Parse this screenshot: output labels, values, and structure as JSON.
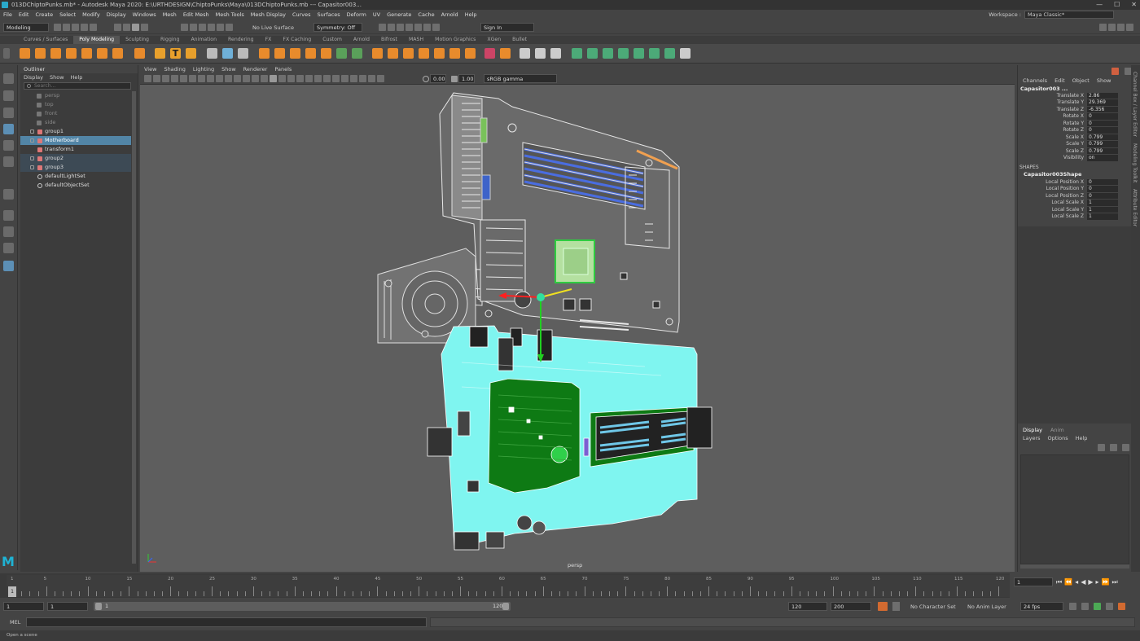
{
  "titlebar": {
    "title": "013DChiptoPunks.mb* - Autodesk Maya 2020: E:\\URTHDESIGN\\ChiptoPunks\\Maya\\013DChiptoPunks.mb   ---   Capasitor003..."
  },
  "window_controls": {
    "minimize": "—",
    "maximize": "☐",
    "close": "✕"
  },
  "menubar": [
    "File",
    "Edit",
    "Create",
    "Select",
    "Modify",
    "Display",
    "Windows",
    "Mesh",
    "Edit Mesh",
    "Mesh Tools",
    "Mesh Display",
    "Curves",
    "Surfaces",
    "Deform",
    "UV",
    "Generate",
    "Cache",
    "Arnold",
    "Help"
  ],
  "workspace": {
    "label": "Workspace :",
    "value": "Maya Classic*"
  },
  "statusline": {
    "mode": "Modeling",
    "live_surface": "No Live Surface",
    "symmetry": "Symmetry: Off",
    "signin": "Sign In"
  },
  "shelf_tabs": [
    "Curves / Surfaces",
    "Poly Modeling",
    "Sculpting",
    "Rigging",
    "Animation",
    "Rendering",
    "FX",
    "FX Caching",
    "Custom",
    "Arnold",
    "Bifrost",
    "MASH",
    "Motion Graphics",
    "XGen",
    "Bullet"
  ],
  "shelf_active": "Poly Modeling",
  "outliner": {
    "title": "Outliner",
    "menu": [
      "Display",
      "Show",
      "Help"
    ],
    "search_placeholder": "Search...",
    "items": [
      {
        "label": "persp",
        "state": "dim",
        "indent": 1
      },
      {
        "label": "top",
        "state": "dim",
        "indent": 1
      },
      {
        "label": "front",
        "state": "dim",
        "indent": 1
      },
      {
        "label": "side",
        "state": "dim",
        "indent": 1
      },
      {
        "label": "group1",
        "state": "normal",
        "indent": 0,
        "expand": true
      },
      {
        "label": "Motherboard",
        "state": "highlight",
        "indent": 0,
        "expand": true
      },
      {
        "label": "transform1",
        "state": "normal",
        "indent": 0
      },
      {
        "label": "group2",
        "state": "selected",
        "indent": 0,
        "expand": true
      },
      {
        "label": "group3",
        "state": "selected",
        "indent": 0,
        "expand": true
      },
      {
        "label": "defaultLightSet",
        "state": "normal",
        "indent": 0
      },
      {
        "label": "defaultObjectSet",
        "state": "normal",
        "indent": 0
      }
    ]
  },
  "viewport": {
    "menu": [
      "View",
      "Shading",
      "Lighting",
      "Show",
      "Renderer",
      "Panels"
    ],
    "exposure": "0.00",
    "gamma": "1.00",
    "colorspace": "sRGB gamma",
    "camera_label": "persp"
  },
  "channel_box": {
    "menu": [
      "Channels",
      "Edit",
      "Object",
      "Show"
    ],
    "object": "Capasitor003 ...",
    "attributes": [
      {
        "name": "Translate X",
        "value": "2.86"
      },
      {
        "name": "Translate Y",
        "value": "29.369"
      },
      {
        "name": "Translate Z",
        "value": "-6.356"
      },
      {
        "name": "Rotate X",
        "value": "0"
      },
      {
        "name": "Rotate Y",
        "value": "0"
      },
      {
        "name": "Rotate Z",
        "value": "0"
      },
      {
        "name": "Scale X",
        "value": "0.799"
      },
      {
        "name": "Scale Y",
        "value": "0.799"
      },
      {
        "name": "Scale Z",
        "value": "0.799"
      },
      {
        "name": "Visibility",
        "value": "on"
      }
    ],
    "shapes_header": "SHAPES",
    "shape_name": "Capasitor003Shape",
    "shape_attributes": [
      {
        "name": "Local Position X",
        "value": "0"
      },
      {
        "name": "Local Position Y",
        "value": "0"
      },
      {
        "name": "Local Position Z",
        "value": "0"
      },
      {
        "name": "Local Scale X",
        "value": "1"
      },
      {
        "name": "Local Scale Y",
        "value": "1"
      },
      {
        "name": "Local Scale Z",
        "value": "1"
      }
    ]
  },
  "layer_editor": {
    "tabs": [
      "Display",
      "Anim"
    ],
    "menu": [
      "Layers",
      "Options",
      "Help"
    ]
  },
  "side_tabs": [
    "Channel Box / Layer Editor",
    "Modeling Toolkit",
    "Attribute Editor"
  ],
  "timeline": {
    "ticks": [
      1,
      5,
      10,
      15,
      20,
      25,
      30,
      35,
      40,
      45,
      50,
      55,
      60,
      65,
      70,
      75,
      80,
      85,
      90,
      95,
      100,
      105,
      110,
      115,
      120
    ],
    "current": "1",
    "current_frame_field": "1"
  },
  "range": {
    "start": "1",
    "playback_start": "1",
    "slider_start": "1",
    "slider_end": "120",
    "playback_end": "120",
    "end": "200",
    "character_set": "No Character Set",
    "anim_layer": "No Anim Layer",
    "fps": "24 fps"
  },
  "cmdline": {
    "label": "MEL"
  },
  "helpline": {
    "text": "Open a scene"
  },
  "colors": {
    "accent": "#5285a6",
    "board_cyan": "#7ff5f0",
    "board_green": "#0e7a14"
  }
}
